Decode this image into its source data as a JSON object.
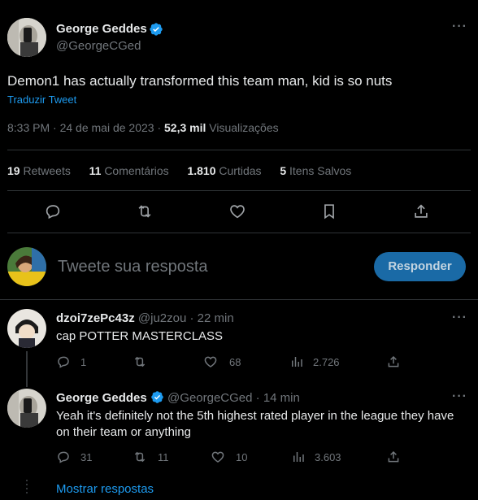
{
  "main_tweet": {
    "author_name": "George Geddes",
    "handle": "@GeorgeCGed",
    "text": "Demon1 has actually transformed this team man, kid is so nuts",
    "translate_label": "Traduzir Tweet",
    "timestamp": "8:33 PM · 24 de mai de 2023 ·",
    "views_count": "52,3 mil",
    "views_label": "Visualizações",
    "stats": {
      "retweets_count": "19",
      "retweets_label": "Retweets",
      "comments_count": "11",
      "comments_label": "Comentários",
      "likes_count": "1.810",
      "likes_label": "Curtidas",
      "saves_count": "5",
      "saves_label": "Itens Salvos"
    }
  },
  "composer": {
    "placeholder": "Tweete sua resposta",
    "reply_button": "Responder"
  },
  "replies": [
    {
      "author_name": "dzoi7zePc43z",
      "handle": "@ju2zou",
      "time": "· 22 min",
      "text": "cap POTTER MASTERCLASS",
      "comments": "1",
      "retweets": "",
      "likes": "68",
      "views": "2.726"
    },
    {
      "author_name": "George Geddes",
      "handle": "@GeorgeCGed",
      "time": "· 14 min",
      "text": "Yeah it's definitely not the 5th highest rated player in the league they have on their team or anything",
      "comments": "31",
      "retweets": "11",
      "likes": "10",
      "views": "3.603"
    }
  ],
  "show_replies_label": "Mostrar respostas",
  "colors": {
    "background": "#000000",
    "accent": "#1d9bf0",
    "muted_text": "#71767b",
    "divider": "#2f3336",
    "reply_button_bg": "#1a6aa6"
  }
}
